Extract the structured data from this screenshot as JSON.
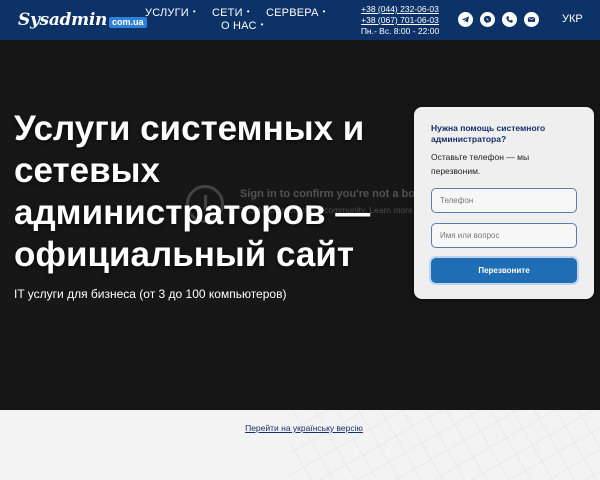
{
  "header": {
    "logo": {
      "name": "Sysadmin",
      "tld": "com.ua"
    },
    "nav": [
      {
        "label": "УСЛУГИ",
        "dot": "•"
      },
      {
        "label": "СЕТИ",
        "dot": "•"
      },
      {
        "label": "СЕРВЕРА",
        "dot": "•"
      },
      {
        "label": "О НАС",
        "dot": "•"
      }
    ],
    "contacts": {
      "phone1": "+38 (044) 232-06-03",
      "phone2": "+38 (067) 701-06-03",
      "hours": "Пн.- Вс. 8:00 - 22:00"
    },
    "socials": [
      "telegram-icon",
      "viber-icon",
      "whatsapp-icon",
      "email-icon"
    ],
    "language": "УКР"
  },
  "hero": {
    "title": "Услуги системных и сетевых администраторов — официальный сайт",
    "subtitle": "IT услуги для бизнеса (от 3 до 100 компьютеров)",
    "embed_overlay": {
      "title": "Sign in to confirm you're not a bot",
      "sub": "This helps protect our community. Learn more"
    }
  },
  "form": {
    "title": "Нужна помощь системного администратора?",
    "description": "Оставьте телефон — мы перезвоним.",
    "phone_placeholder": "Телефон",
    "name_placeholder": "Имя или вопрос",
    "submit_label": "Перезвоните"
  },
  "footer": {
    "ua_link": "Перейти на українську версію"
  },
  "colors": {
    "header_bg": "#0d3268",
    "hero_bg": "#171717",
    "accent": "#1f6db5",
    "form_title": "#14306a"
  }
}
